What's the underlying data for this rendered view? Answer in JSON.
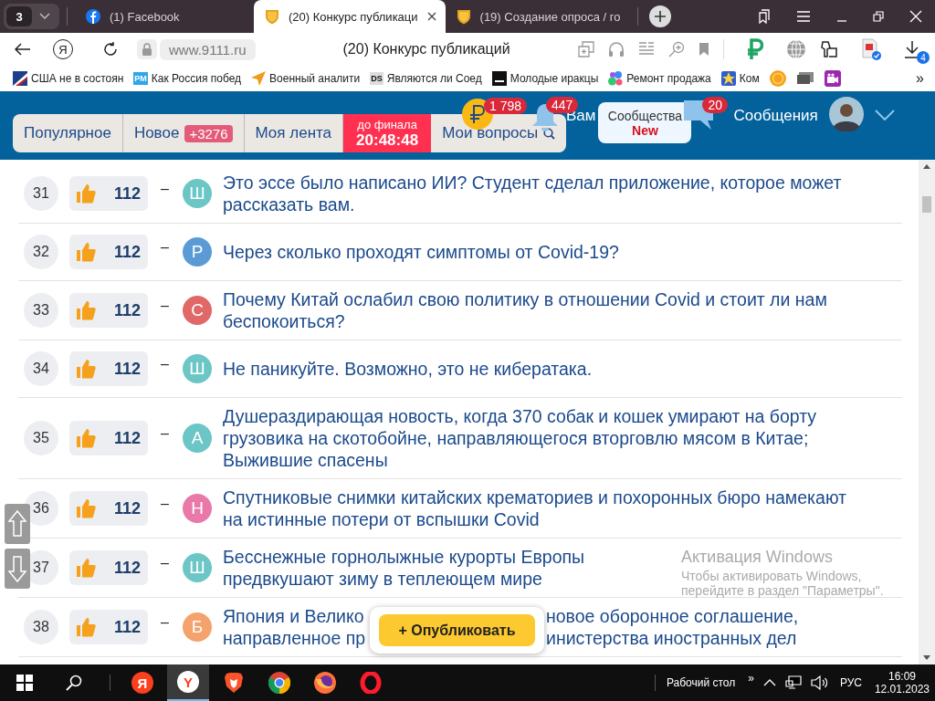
{
  "browser": {
    "tab_count": "3",
    "tabs": [
      {
        "title": "(1) Facebook",
        "kind": "facebook",
        "selected": false
      },
      {
        "title": "(20) Конкурс публикаци",
        "kind": "shield",
        "selected": true
      },
      {
        "title": "(19) Создание опроса / го",
        "kind": "shield",
        "selected": false
      }
    ],
    "home_logo": "Я",
    "address": "www.9111.ru",
    "page_title": "(20) Конкурс публикаций",
    "download_count": "4",
    "bookmarks": [
      {
        "kind": "flag",
        "title": "США не в состоян"
      },
      {
        "kind": "logo",
        "logo": "PM",
        "title": "Как Россия побед"
      },
      {
        "kind": "arrow",
        "title": "Военный аналити"
      },
      {
        "kind": "logo",
        "logo": "DS",
        "title": "Являются ли Соед"
      },
      {
        "kind": "bar",
        "title": "Молодые иракцы"
      },
      {
        "kind": "dots",
        "title": "Ремонт продажа"
      },
      {
        "kind": "star",
        "title": "Ком"
      },
      {
        "kind": "coin"
      },
      {
        "kind": "screen"
      },
      {
        "kind": "camera"
      }
    ],
    "more": "»"
  },
  "site": {
    "nav": [
      {
        "kind": "tab",
        "label": "Популярное",
        "selected": false
      },
      {
        "kind": "tab",
        "label": "Новое",
        "badge": "+3276",
        "selected": false
      },
      {
        "kind": "tab",
        "label": "Моя лента",
        "selected": false
      },
      {
        "kind": "timer",
        "label": "до финала",
        "time": "20:48:48"
      },
      {
        "kind": "tab",
        "label": "Мои вопросы",
        "selected": false
      }
    ],
    "coin_badge": "1 798",
    "bell_badge": "447",
    "greeting": "Вам",
    "communities": {
      "label": "Сообщества",
      "tag": "New"
    },
    "messages_badge": "20",
    "messages": "Сообщения"
  },
  "rows": [
    {
      "kind": "plain",
      "rank": "31",
      "likes": "112",
      "dash": "–",
      "avatar": "Ш",
      "color": "#6cc6c6",
      "title": "Это эссе было написано ИИ? Студент сделал приложение, которое может рассказать вам."
    },
    {
      "kind": "plain",
      "rank": "32",
      "likes": "112",
      "dash": "–",
      "avatar": "Р",
      "color": "#5b9bd5",
      "title": "Через сколько проходят симптомы от Covid-19?"
    },
    {
      "kind": "plain",
      "rank": "33",
      "likes": "112",
      "dash": "–",
      "avatar": "С",
      "color": "#e06868",
      "title": "Почему Китай ослабил свою политику в отношении Covid и стоит ли нам беспокоиться?"
    },
    {
      "kind": "plain",
      "rank": "34",
      "likes": "112",
      "dash": "–",
      "avatar": "Ш",
      "color": "#6cc6c6",
      "title": "Не паникуйте. Возможно, это не кибератака."
    },
    {
      "kind": "plain",
      "rank": "35",
      "likes": "112",
      "dash": "–",
      "avatar": "А",
      "color": "#6cc6c6",
      "title": "Душераздирающая новость, когда 370 собак и кошек умирают на борту грузовика на скотобойне, направляющегося вторговлю мясом в Китае; Выжившие спасены"
    },
    {
      "kind": "plain",
      "rank": "36",
      "likes": "112",
      "dash": "–",
      "avatar": "Н",
      "color": "#e879a8",
      "title": "Спутниковые снимки китайских крематориев и похоронных бюро намекают на истинные потери от вспышки Covid"
    },
    {
      "kind": "plain",
      "rank": "37",
      "likes": "112",
      "dash": "–",
      "avatar": "Ш",
      "color": "#6cc6c6",
      "title": "Бесснежные горнолыжные курорты Европы предвкушают зиму в теплеющем мире"
    },
    {
      "kind": "covered",
      "rank": "38",
      "likes": "112",
      "dash": "–",
      "avatar": "Б",
      "color": "#f4a36c",
      "lines": [
        [
          "Япония и Велико",
          "новое оборонное соглашение,"
        ],
        [
          "направленное пр",
          "инистерства иностранных дел"
        ]
      ]
    }
  ],
  "publish": "+ Опубликовать",
  "activation": {
    "title": "Активация Windows",
    "lines": [
      "Чтобы активировать Windows,",
      "перейдите в раздел \"Параметры\"."
    ]
  },
  "taskbar": {
    "apps": [
      {
        "kind": "yandex",
        "logo": "Я",
        "active": false
      },
      {
        "kind": "ybrowser",
        "logo": "Y",
        "active": true
      },
      {
        "kind": "brave",
        "active": false
      },
      {
        "kind": "chrome",
        "active": false
      },
      {
        "kind": "firefox",
        "active": false
      },
      {
        "kind": "opera",
        "active": false
      }
    ],
    "desktop": "Рабочий стол",
    "chevron": "»",
    "lang": "РУС",
    "time": "16:09",
    "date": "12.01.2023"
  }
}
